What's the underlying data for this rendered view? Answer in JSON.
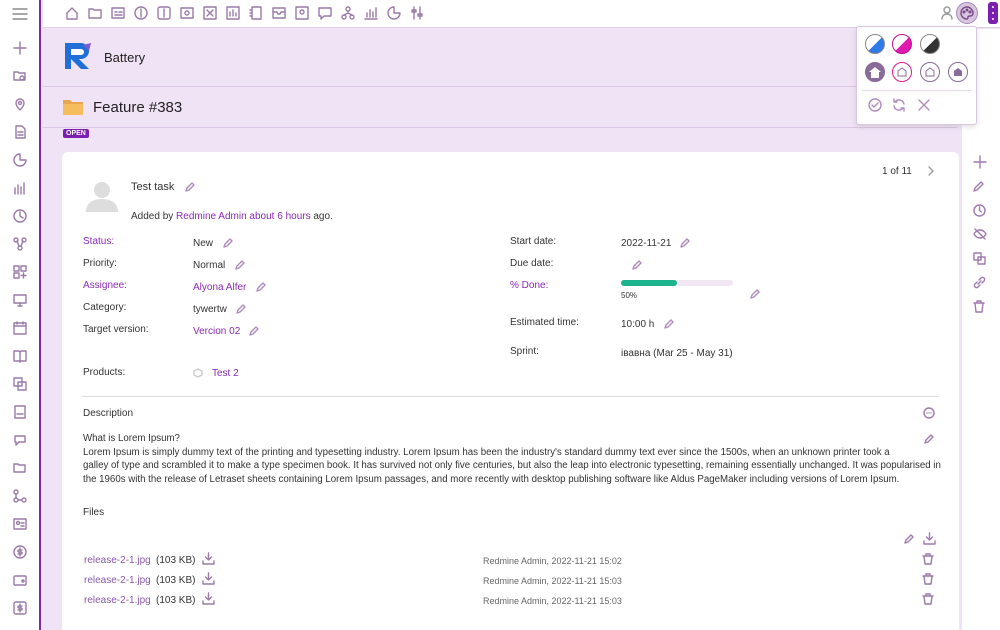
{
  "header": {
    "project_name": "Battery"
  },
  "issue": {
    "title": "Feature #383",
    "status_badge": "OPEN",
    "subject": "Test task",
    "added_prefix": "Added by",
    "author": "Redmine Admin",
    "age": "about 6 hours",
    "added_suffix": "ago.",
    "pager": "1 of 11"
  },
  "attributes": {
    "status": {
      "label": "Status:",
      "value": "New"
    },
    "priority": {
      "label": "Priority:",
      "value": "Normal"
    },
    "assignee": {
      "label": "Assignee:",
      "value": "Alyona Alfer"
    },
    "category": {
      "label": "Category:",
      "value": "tywertw"
    },
    "target_version": {
      "label": "Target version:",
      "value": "Vercion 02"
    },
    "products": {
      "label": "Products:",
      "value": "Test 2"
    },
    "start_date": {
      "label": "Start date:",
      "value": "2022-11-21"
    },
    "due_date": {
      "label": "Due date:",
      "value": ""
    },
    "done": {
      "label": "% Done:",
      "value": "50%",
      "fraction": 0.5
    },
    "estimated_time": {
      "label": "Estimated time:",
      "value": "10:00 h"
    },
    "sprint": {
      "label": "Sprint:",
      "value": "івавна (Mar 25 - May 31)"
    }
  },
  "description": {
    "heading": "Description",
    "title": "What is Lorem Ipsum?",
    "line1": "Lorem Ipsum is simply dummy text of the printing and typesetting industry. Lorem Ipsum has been the industry's standard dummy text ever since the 1500s, when an unknown printer took a",
    "line2": "galley of type and scrambled it to make a type specimen book. It has survived not only five centuries, but also the leap into electronic typesetting, remaining essentially unchanged. It was popularised in",
    "line3": "the 1960s with the release of Letraset sheets containing Lorem Ipsum passages, and more recently with desktop publishing software like Aldus PageMaker including versions of Lorem Ipsum."
  },
  "files": {
    "heading": "Files",
    "items": [
      {
        "name": "release-2-1.jpg",
        "size": "(103 KB)",
        "meta": "Redmine Admin, 2022-11-21 15:02"
      },
      {
        "name": "release-2-1.jpg",
        "size": "(103 KB)",
        "meta": "Redmine Admin, 2022-11-21 15:03"
      },
      {
        "name": "release-2-1.jpg",
        "size": "(103 KB)",
        "meta": "Redmine Admin, 2022-11-21 15:03"
      }
    ]
  },
  "colors": {
    "accent": "#7a1fb0",
    "link": "#8a2ab8",
    "progress": "#1db38c",
    "band": "#f1e3f6"
  }
}
